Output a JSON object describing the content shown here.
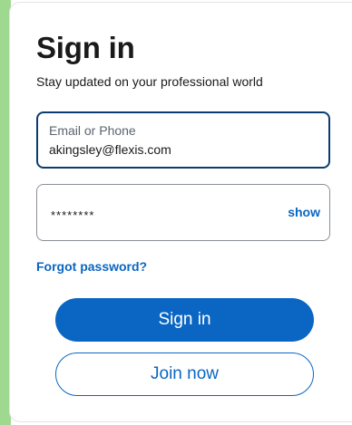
{
  "signin": {
    "title": "Sign in",
    "subtitle": "Stay updated on your professional world",
    "email_label": "Email or Phone",
    "email_value": "akingsley@flexis.com",
    "password_masked": "********",
    "show_label": "show",
    "forgot_label": "Forgot password?",
    "signin_button": "Sign in",
    "join_button": "Join now"
  },
  "colors": {
    "accent": "#0a66c2",
    "focus_border": "#0a3c72",
    "side_accent": "#9ed98f"
  }
}
